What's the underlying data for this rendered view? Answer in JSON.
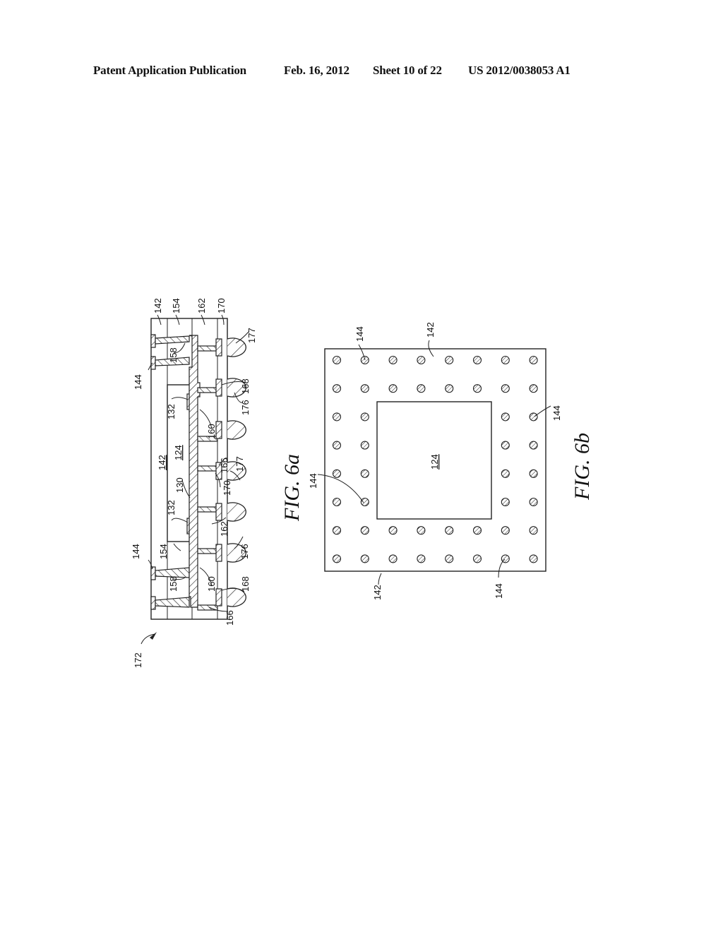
{
  "header": {
    "publication": "Patent Application Publication",
    "date": "Feb. 16, 2012",
    "sheet": "Sheet 10 of 22",
    "number": "US 2012/0038053 A1"
  },
  "fig6a": {
    "caption": "FIG. 6a",
    "labels": {
      "l142_top": "142",
      "l154_top": "154",
      "l162_top": "162",
      "l170_top": "170",
      "l177_a": "177",
      "l158_a": "158",
      "l144_a": "144",
      "l168_a": "168",
      "l176_a": "176",
      "l132_a": "132",
      "l160_a": "160",
      "l124": "124",
      "l142_mid": "142",
      "l166_a": "166",
      "l177_b": "177",
      "l130": "130",
      "l170_b": "170",
      "l132_b": "132",
      "l162_b": "162",
      "l144_b": "144",
      "l154_b": "154",
      "l176_b": "176",
      "l158_b": "158",
      "l160_b": "160",
      "l168_b": "168",
      "l166_b": "166",
      "l172": "172"
    }
  },
  "fig6b": {
    "caption": "FIG. 6b",
    "labels": {
      "l144_tl": "144",
      "l142_top": "142",
      "l144_right": "144",
      "l124": "124",
      "l144_left": "144",
      "l142_bottom": "142",
      "l144_bottom": "144"
    },
    "via_grid": {
      "rows": 8,
      "cols": 8,
      "die_opening_rows": [
        2,
        5
      ],
      "die_opening_cols": [
        2,
        5
      ]
    }
  }
}
